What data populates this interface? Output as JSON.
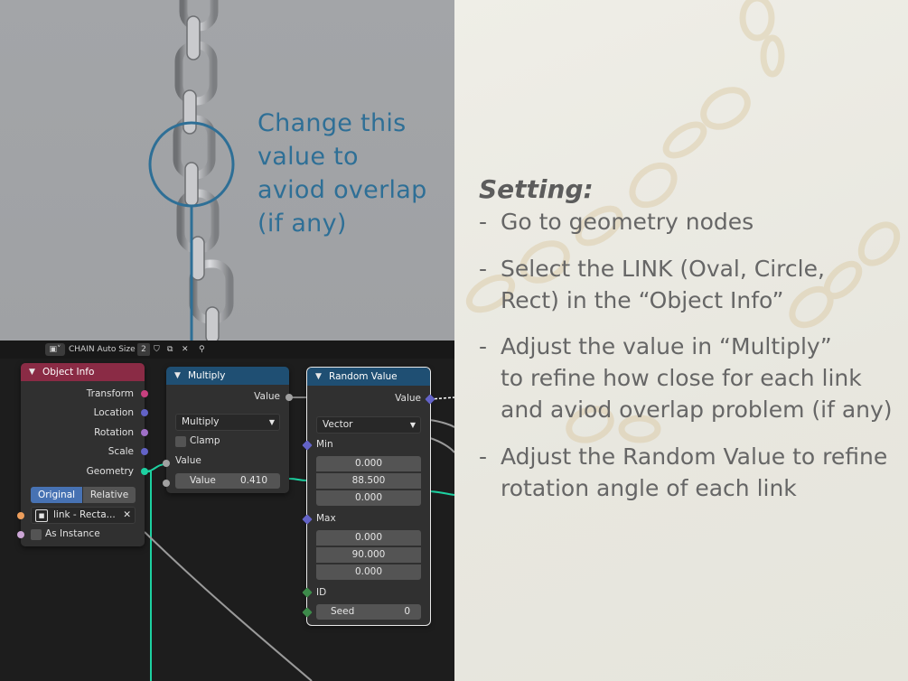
{
  "viewport": {
    "annotation_lines": [
      "Change this",
      "value to",
      "aviod overlap",
      "(if any)"
    ]
  },
  "header": {
    "object_name": "CHAIN Auto Size",
    "user_count": "2"
  },
  "nodes": {
    "object_info": {
      "title": "Object Info",
      "outputs": [
        "Transform",
        "Location",
        "Rotation",
        "Scale",
        "Geometry"
      ],
      "toggle": [
        "Original",
        "Relative"
      ],
      "object_value": "link - Recta...",
      "as_instance": "As Instance"
    },
    "multiply": {
      "title": "Multiply",
      "output": "Value",
      "operation": "Multiply",
      "clamp": "Clamp",
      "input_a": "Value",
      "input_b_label": "Value",
      "input_b_value": "0.410"
    },
    "random_value": {
      "title": "Random Value",
      "output": "Value",
      "type": "Vector",
      "min_label": "Min",
      "min_values": [
        "0.000",
        "88.500",
        "0.000"
      ],
      "max_label": "Max",
      "max_values": [
        "0.000",
        "90.000",
        "0.000"
      ],
      "id_label": "ID",
      "seed_label": "Seed",
      "seed_value": "0"
    }
  },
  "panel": {
    "title": "Setting:",
    "bullets": [
      [
        "Go to geometry nodes"
      ],
      [
        "Select the LINK (Oval, Circle,",
        "Rect) in the “Object Info”"
      ],
      [
        "Adjust the value in “Multiply”",
        "to refine how close for each link",
        "and aviod overlap problem (if any)"
      ],
      [
        "Adjust the Random Value to refine",
        "rotation angle of each link"
      ]
    ]
  },
  "colors": {
    "annotation_blue": "#2e6f96",
    "object_info_header": "#8a2b45",
    "math_header": "#1f4f73",
    "geometry_socket": "#1dd1a1",
    "float_socket": "#a1a1a1",
    "vector_socket": "#6363c7",
    "object_socket": "#ed9e5c",
    "bool_socket": "#cca6d6",
    "int_socket": "#3d8a4a"
  }
}
